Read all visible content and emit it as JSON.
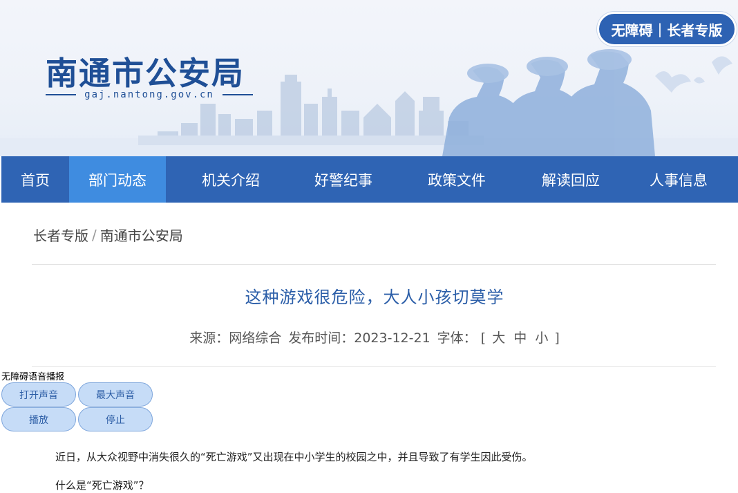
{
  "header": {
    "site_title": "南通市公安局",
    "site_domain": "gaj.nantong.gov.cn",
    "accessibility": {
      "left_label": "无障碍",
      "separator": "|",
      "right_label": "长者专版"
    }
  },
  "nav": {
    "items": [
      {
        "label": "首页"
      },
      {
        "label": "部门动态",
        "active": true
      },
      {
        "label": "机关介绍"
      },
      {
        "label": "好警纪事"
      },
      {
        "label": "政策文件"
      },
      {
        "label": "解读回应"
      },
      {
        "label": "人事信息"
      }
    ]
  },
  "breadcrumb": {
    "home": "长者专版",
    "separator": "/",
    "current": "南通市公安局"
  },
  "article": {
    "title": "这种游戏很危险，大人小孩切莫学",
    "source_label": "来源：",
    "source": "网络综合",
    "date_label": "发布时间：",
    "date": "2023-12-21",
    "font_label": "字体：",
    "bracket_open": "[",
    "size_large": "大",
    "size_medium": "中",
    "size_small": "小",
    "bracket_close": "]"
  },
  "voice": {
    "label": "无障碍语音播报",
    "open_sound": "打开声音",
    "max_volume": "最大声音",
    "play": "播放",
    "stop": "停止"
  },
  "body": {
    "paragraph1": "近日，从大众视野中消失很久的“死亡游戏”又出现在中小学生的校园之中，并且导致了有学生因此受伤。",
    "paragraph2": "什么是“死亡游戏”？"
  },
  "colors": {
    "brand_blue": "#2f64b4",
    "nav_active": "#3f8ce0",
    "title_blue": "#2b5ea8"
  }
}
